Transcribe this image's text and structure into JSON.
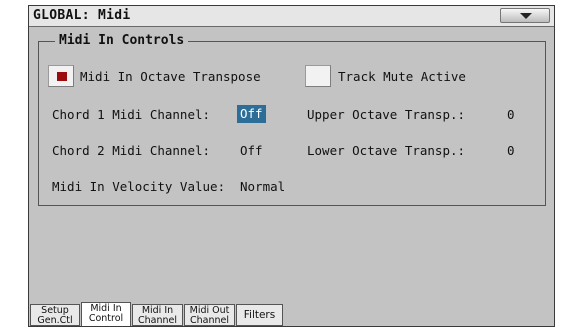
{
  "window": {
    "title": "GLOBAL: Midi"
  },
  "group": {
    "title": "Midi In Controls",
    "octave_transpose": {
      "label": "Midi In Octave Transpose",
      "checked": true
    },
    "track_mute": {
      "label": "Track Mute Active",
      "checked": false
    },
    "chord1": {
      "label": "Chord 1 Midi Channel:",
      "value": "Off",
      "selected": true
    },
    "chord2": {
      "label": "Chord 2 Midi Channel:",
      "value": "Off"
    },
    "upper_transp": {
      "label": "Upper Octave Transp.:",
      "value": "0"
    },
    "lower_transp": {
      "label": "Lower Octave Transp.:",
      "value": "0"
    },
    "velocity": {
      "label": "Midi In Velocity Value:",
      "value": "Normal"
    }
  },
  "tabs": [
    {
      "line1": "Setup",
      "line2": "Gen.Ctl"
    },
    {
      "line1": "Midi In",
      "line2": "Control",
      "active": true
    },
    {
      "line1": "Midi In",
      "line2": "Channel"
    },
    {
      "line1": "Midi Out",
      "line2": "Channel"
    },
    {
      "line1": "Filters",
      "line2": ""
    }
  ],
  "colors": {
    "accent": "#2c6e98",
    "check_mark": "#9b0d0d",
    "panel": "#c3c3c3"
  },
  "icons": {
    "menu": "dropdown-triangle-icon"
  }
}
